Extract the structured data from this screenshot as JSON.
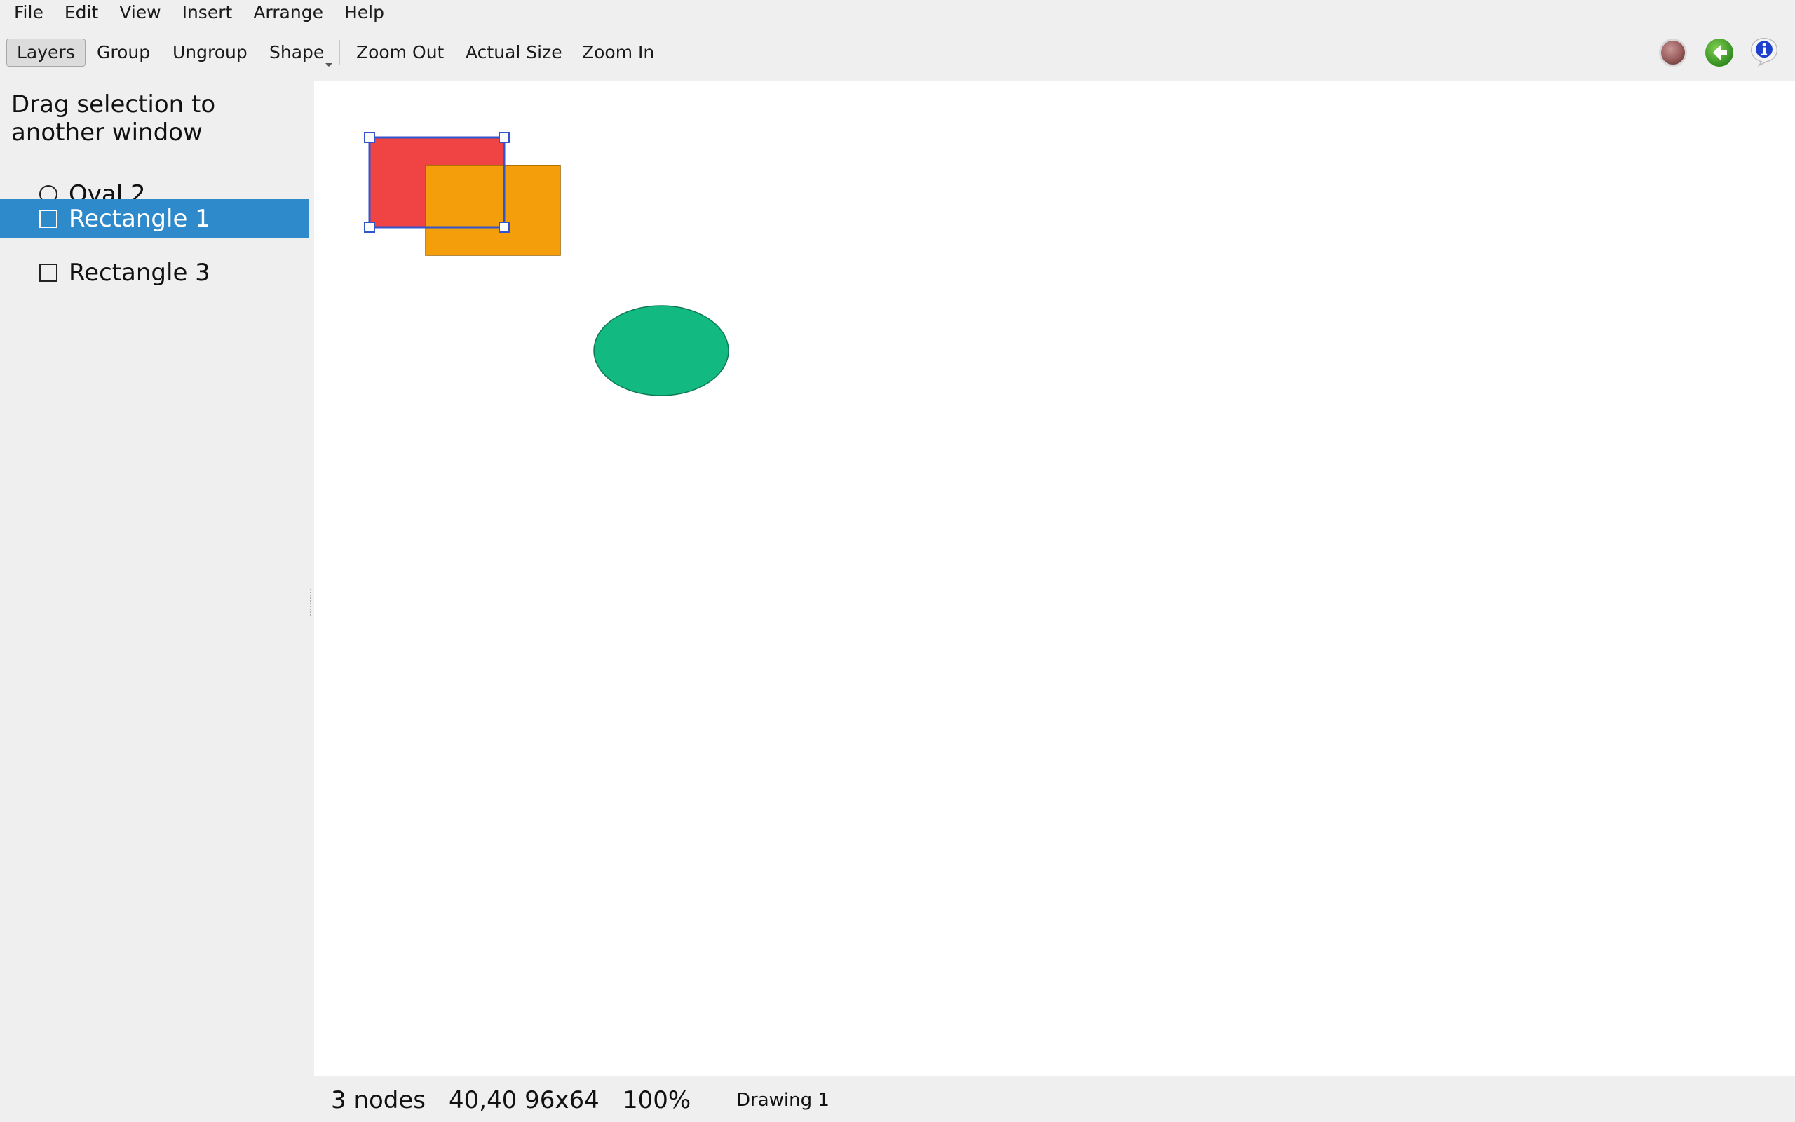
{
  "menu": {
    "items": [
      "File",
      "Edit",
      "View",
      "Insert",
      "Arrange",
      "Help"
    ]
  },
  "toolbar": {
    "layers_label": "Layers",
    "group_label": "Group",
    "ungroup_label": "Ungroup",
    "shape_label": "Shape",
    "zoom_out_label": "Zoom Out",
    "actual_size_label": "Actual Size",
    "zoom_in_label": "Zoom In",
    "icons": [
      "record-icon",
      "back-arrow-icon",
      "info-icon"
    ]
  },
  "sidebar": {
    "hint": "Drag selection to another window",
    "layers": [
      {
        "label": "Oval 2",
        "icon": "circle-icon",
        "selected": false
      },
      {
        "label": "Rectangle 1",
        "icon": "square-icon",
        "selected": true
      },
      {
        "label": "Rectangle 3",
        "icon": "square-icon",
        "selected": false
      }
    ]
  },
  "canvas": {
    "shapes": [
      {
        "name": "Rectangle 1",
        "fill": "#f04444"
      },
      {
        "name": "Rectangle 3",
        "fill": "#f59e0b"
      },
      {
        "name": "Oval 2",
        "fill": "#12b981"
      }
    ],
    "selection_color": "#3355cc"
  },
  "status": {
    "nodes": "3 nodes",
    "geometry": "40,40 96x64",
    "zoom": "100%",
    "document": "Drawing 1"
  },
  "colors": {
    "selection_highlight": "#2f8acb",
    "canvas_background": "#ffffff",
    "chrome_background": "#efefef"
  }
}
